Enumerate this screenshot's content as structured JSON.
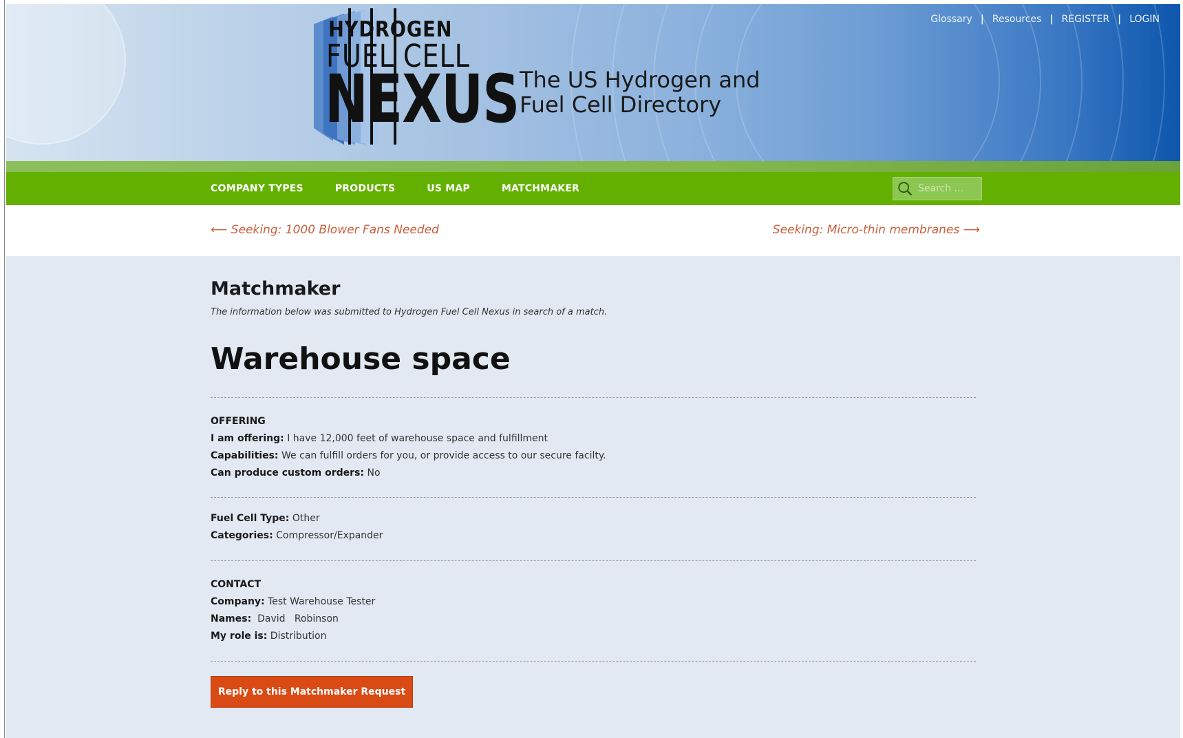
{
  "header": {
    "logo_line1": "HYDROGEN",
    "logo_line2": "FUEL CELL",
    "logo_line3": "NEXUS",
    "tagline_line1": "The US Hydrogen and",
    "tagline_line2": "Fuel Cell Directory",
    "top_links": [
      "Glossary",
      "Resources",
      "REGISTER",
      "LOGIN"
    ],
    "separator": "|"
  },
  "nav": {
    "items": [
      "COMPANY TYPES",
      "PRODUCTS",
      "US MAP",
      "MATCHMAKER"
    ],
    "search_placeholder": "Search ..."
  },
  "postnav": {
    "prev": "⟵ Seeking: 1000 Blower Fans Needed",
    "next": "Seeking: Micro-thin membranes ⟶"
  },
  "main": {
    "section_title": "Matchmaker",
    "subtitle": "The information below was submitted to Hydrogen Fuel Cell Nexus in search of a match.",
    "post_title": "Warehouse space",
    "offering": {
      "heading": "OFFERING",
      "offering_label": "I am offering:",
      "offering_value": " I have 12,000 feet of warehouse space and fulfillment",
      "capabilities_label": "Capabilities:",
      "capabilities_value": " We can fulfill orders for you, or provide access to our secure facilty.",
      "custom_label": "Can produce custom orders:",
      "custom_value": " No"
    },
    "details": {
      "fuel_cell_label": "Fuel Cell Type:",
      "fuel_cell_value": " Other",
      "categories_label": "Categories:",
      "categories_value": " Compressor/Expander"
    },
    "contact": {
      "heading": "CONTACT",
      "company_label": "Company:",
      "company_value": " Test Warehouse Tester",
      "names_label": "Names:",
      "names_value": "  David   Robinson",
      "role_label": "My role is:",
      "role_value": " Distribution"
    },
    "reply_button": "Reply to this Matchmaker Request"
  },
  "colors": {
    "nav_green": "#63b000",
    "accent_orange": "#d94a14",
    "link_orange": "#c9603c",
    "content_bg": "#e2e9f3"
  }
}
